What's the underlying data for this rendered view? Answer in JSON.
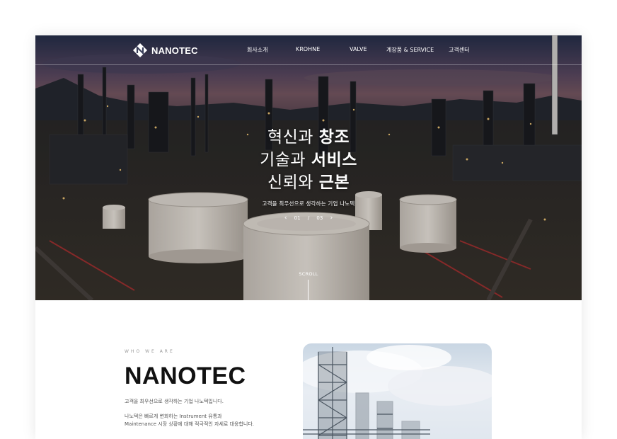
{
  "nav": {
    "brand": "NANOTEC",
    "items": [
      "회사소개",
      "KROHNE",
      "VALVE",
      "계장품 & SERVICE",
      "고객센터"
    ]
  },
  "hero": {
    "lines": [
      {
        "normal": "혁신과 ",
        "bold": "창조"
      },
      {
        "normal": "기술과 ",
        "bold": "서비스"
      },
      {
        "normal": "신뢰와 ",
        "bold": "근본"
      }
    ],
    "subtitle": "고객을 최우선으로 생각하는 기업 나노텍",
    "pager": {
      "current": "01",
      "separator": "/",
      "total": "03",
      "prev": "‹",
      "next": "›"
    },
    "scroll_label": "SCROLL"
  },
  "about": {
    "eyebrow": "WHO WE ARE",
    "title": "NANOTEC",
    "subtitle": "고객을 최우선으로 생각하는 기업 나노텍입니다.",
    "desc_line1": "나노텍은 빠르게 변화하는 Instrument 유통과",
    "desc_line2": "Maintenance 시장 상황에 대해 적극적인 자세로 대응합니다."
  },
  "colors": {
    "text_dark": "#111111",
    "text_muted": "#555555",
    "hero_text": "#ffffff"
  }
}
